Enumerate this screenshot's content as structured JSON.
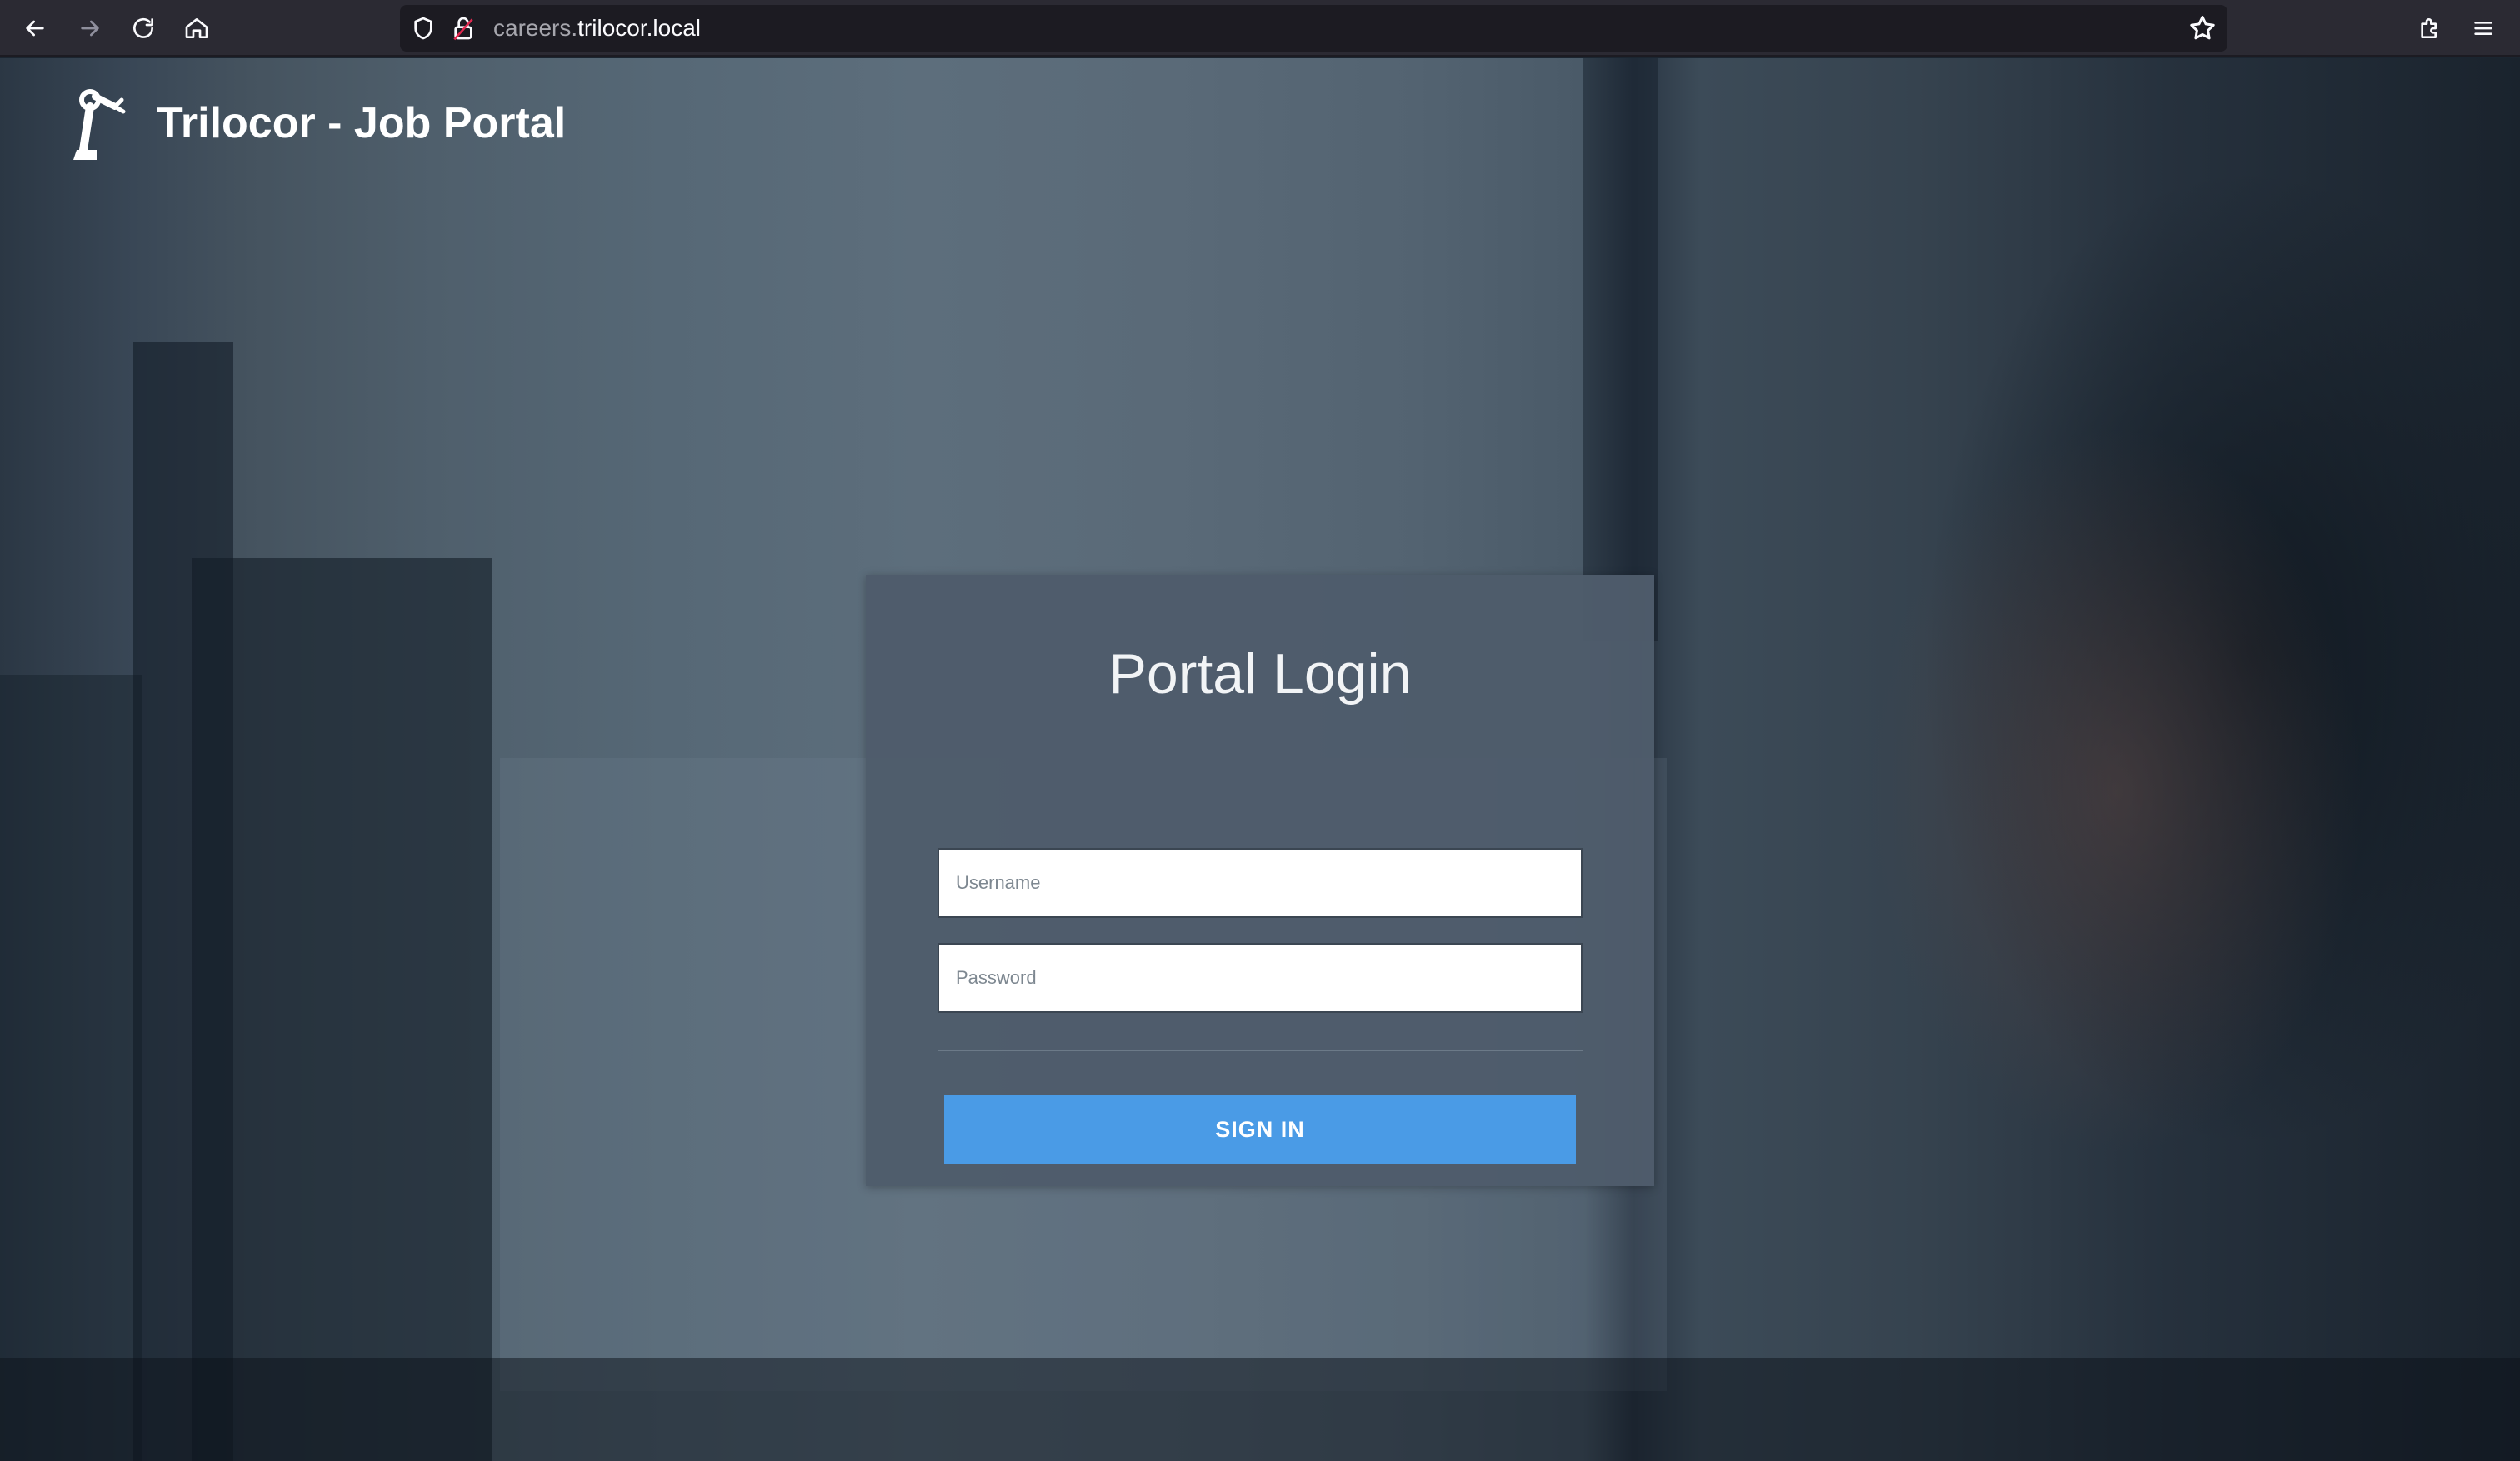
{
  "browser": {
    "url_domain_prefix": "careers.",
    "url_domain_main": "trilocor.local",
    "icons": {
      "back": "arrow-left-icon",
      "forward": "arrow-right-icon",
      "reload": "reload-icon",
      "home": "home-icon",
      "tracking": "shield-icon",
      "security": "lock-icon",
      "bookmark": "star-icon",
      "extensions": "puzzle-icon",
      "menu": "hamburger-menu-icon"
    }
  },
  "header": {
    "logo_icon": "robotic-arm-icon",
    "title": "Trilocor - Job Portal"
  },
  "login": {
    "title": "Portal Login",
    "username_placeholder": "Username",
    "username_value": "",
    "password_placeholder": "Password",
    "password_value": "",
    "submit_label": "SIGN IN"
  },
  "colors": {
    "accent": "#4a9be6",
    "card": "#4e5c6b",
    "chrome": "#2b2a33",
    "urlbar": "#1c1b22"
  }
}
